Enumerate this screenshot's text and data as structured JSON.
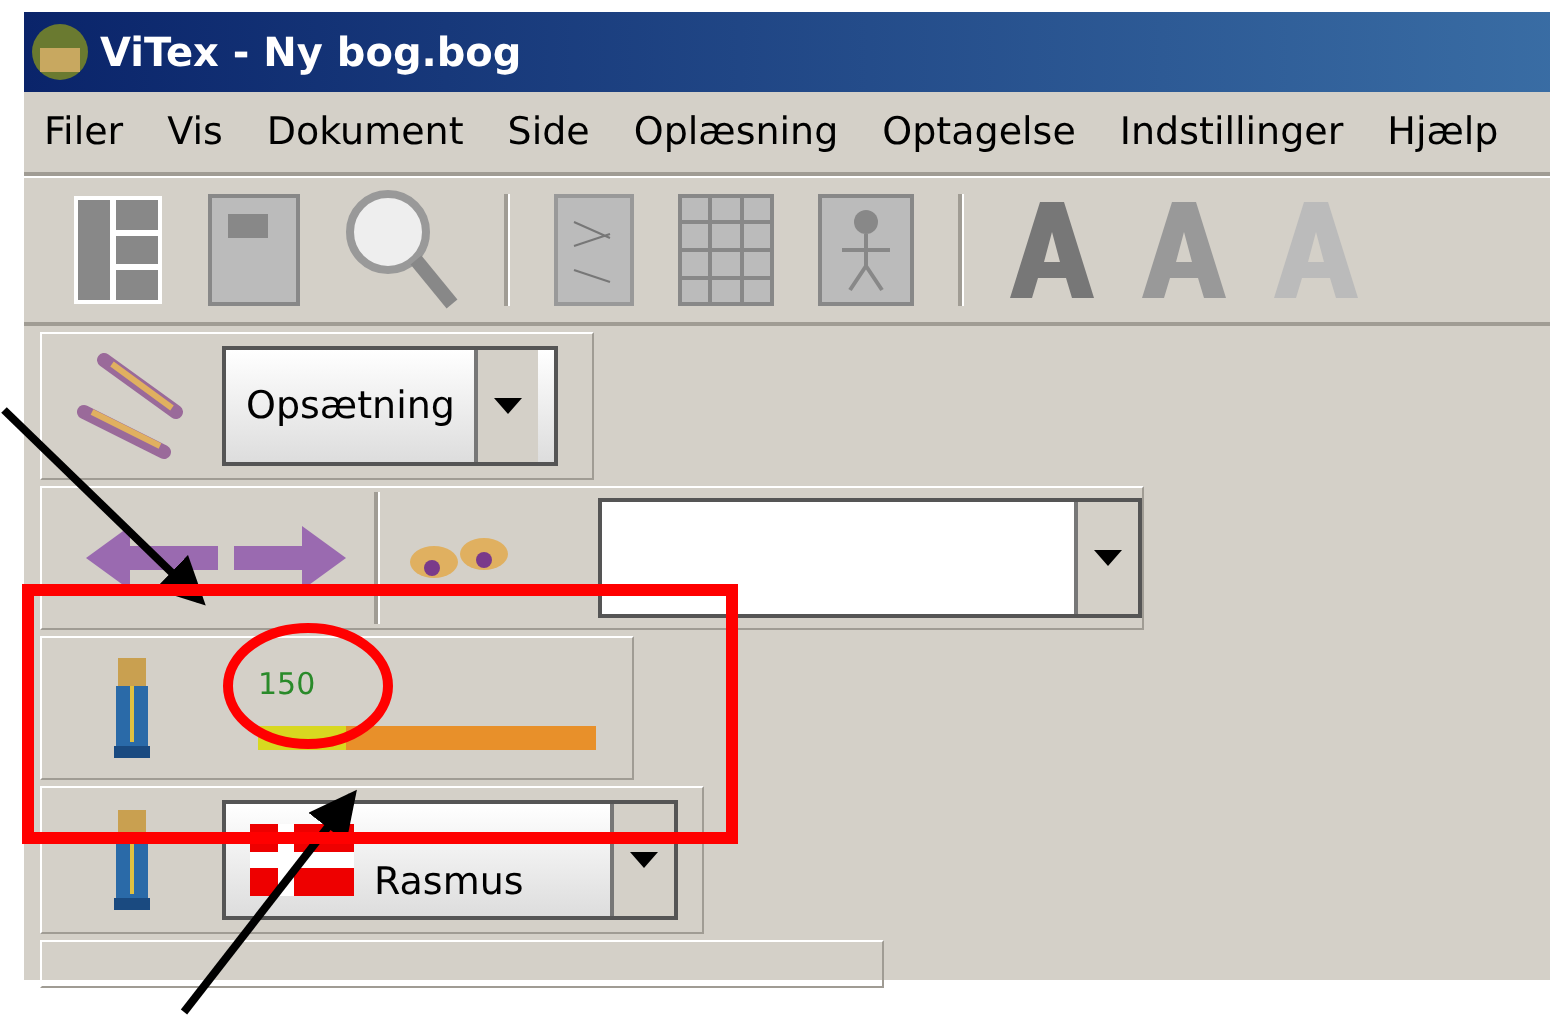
{
  "window": {
    "title": "ViTex - Ny bog.bog"
  },
  "menu": [
    "Filer",
    "Vis",
    "Dokument",
    "Side",
    "Oplæsning",
    "Optagelse",
    "Indstillinger",
    "Hjælp"
  ],
  "profile_combo": {
    "value": "Opsætning"
  },
  "speed": {
    "value": "150",
    "level": 0.26
  },
  "voice_combo": {
    "value": "Rasmus"
  }
}
